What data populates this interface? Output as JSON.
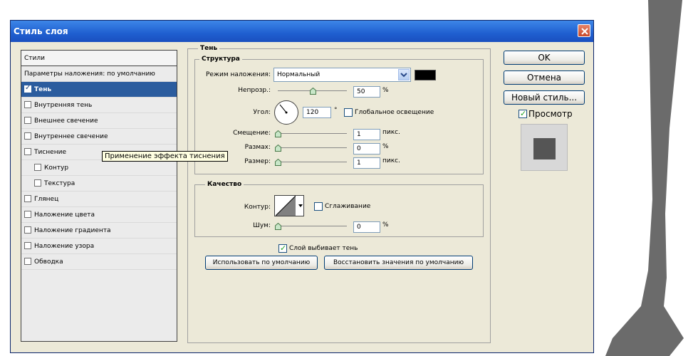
{
  "dialog": {
    "title": "Стиль слоя"
  },
  "styles_list": {
    "header": "Стили",
    "items": [
      {
        "label": "Параметры наложения: по умолчанию",
        "checkbox": false,
        "checked": false,
        "selected": false
      },
      {
        "label": "Тень",
        "checkbox": true,
        "checked": true,
        "selected": true
      },
      {
        "label": "Внутренняя тень",
        "checkbox": true,
        "checked": false,
        "selected": false
      },
      {
        "label": "Внешнее свечение",
        "checkbox": true,
        "checked": false,
        "selected": false
      },
      {
        "label": "Внутреннее свечение",
        "checkbox": true,
        "checked": false,
        "selected": false
      },
      {
        "label": "Тиснение",
        "checkbox": true,
        "checked": false,
        "selected": false
      },
      {
        "label": "Контур",
        "checkbox": true,
        "checked": false,
        "selected": false
      },
      {
        "label": "Текстура",
        "checkbox": true,
        "checked": false,
        "selected": false
      },
      {
        "label": "Глянец",
        "checkbox": true,
        "checked": false,
        "selected": false
      },
      {
        "label": "Наложение цвета",
        "checkbox": true,
        "checked": false,
        "selected": false
      },
      {
        "label": "Наложение градиента",
        "checkbox": true,
        "checked": false,
        "selected": false
      },
      {
        "label": "Наложение узора",
        "checkbox": true,
        "checked": false,
        "selected": false
      },
      {
        "label": "Обводка",
        "checkbox": true,
        "checked": false,
        "selected": false
      }
    ]
  },
  "tooltip": "Применение эффекта тиснения",
  "shadow": {
    "group_title": "Тень",
    "structure": {
      "title": "Структура",
      "blend_mode_label": "Режим наложения:",
      "blend_mode_value": "Нормальный",
      "shadow_color": "#000000",
      "opacity_label": "Непрозр.:",
      "opacity_value": "50",
      "opacity_unit": "%",
      "opacity_fraction": 0.5,
      "angle_label": "Угол:",
      "angle_value": "120",
      "angle_unit": "°",
      "global_light_label": "Глобальное освещение",
      "global_light_checked": false,
      "distance_label": "Смещение:",
      "distance_value": "1",
      "distance_unit": "пикс.",
      "spread_label": "Размах:",
      "spread_value": "0",
      "spread_unit": "%",
      "size_label": "Размер:",
      "size_value": "1",
      "size_unit": "пикс."
    },
    "quality": {
      "title": "Качество",
      "contour_label": "Контур:",
      "antialias_label": "Сглаживание",
      "antialias_checked": false,
      "noise_label": "Шум:",
      "noise_value": "0",
      "noise_unit": "%"
    },
    "layer_knocks_out_label": "Слой выбивает тень",
    "layer_knocks_out_checked": true,
    "make_default_button": "Использовать по умолчанию",
    "reset_default_button": "Восстановить значения по умолчанию"
  },
  "actions": {
    "ok": "OK",
    "cancel": "Отмена",
    "new_style": "Новый стиль...",
    "preview_label": "Просмотр",
    "preview_checked": true
  },
  "colors": {
    "titlebar": "#1f5fd0",
    "selection": "#2b5c9e",
    "dialog_bg": "#ece9d8"
  }
}
